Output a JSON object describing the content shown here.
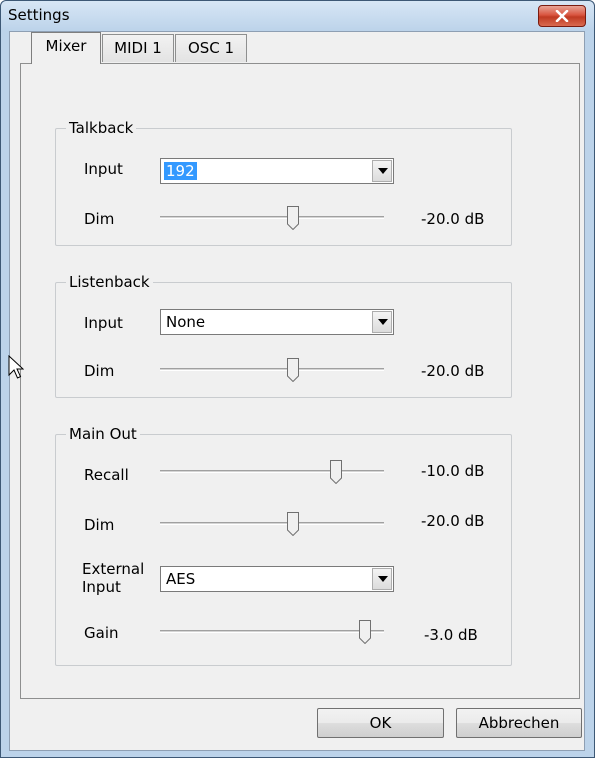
{
  "window": {
    "title": "Settings"
  },
  "tabs": [
    {
      "label": "Mixer"
    },
    {
      "label": "MIDI 1"
    },
    {
      "label": "OSC 1"
    }
  ],
  "talkback": {
    "title": "Talkback",
    "input_label": "Input",
    "input_value": "192",
    "dim_label": "Dim",
    "dim_value": "-20.0 dB",
    "dim_level": 0.6
  },
  "listenback": {
    "title": "Listenback",
    "input_label": "Input",
    "input_value": "None",
    "dim_label": "Dim",
    "dim_value": "-20.0 dB",
    "dim_level": 0.6
  },
  "main_out": {
    "title": "Main Out",
    "recall_label": "Recall",
    "recall_value": "-10.0 dB",
    "recall_level": 0.8,
    "dim_label": "Dim",
    "dim_value": "-20.0 dB",
    "dim_level": 0.6,
    "external_input_label_line1": "External",
    "external_input_label_line2": "Input",
    "external_input_value": "AES",
    "gain_label": "Gain",
    "gain_value": "-3.0 dB",
    "gain_level": 0.94
  },
  "buttons": {
    "ok": "OK",
    "cancel": "Abbrechen"
  },
  "colors": {
    "accent": "#3399ff",
    "close": "#c7432a"
  },
  "icons": {
    "close": "close-icon",
    "dropdown": "chevron-down-icon",
    "cursor": "mouse-pointer-icon"
  }
}
